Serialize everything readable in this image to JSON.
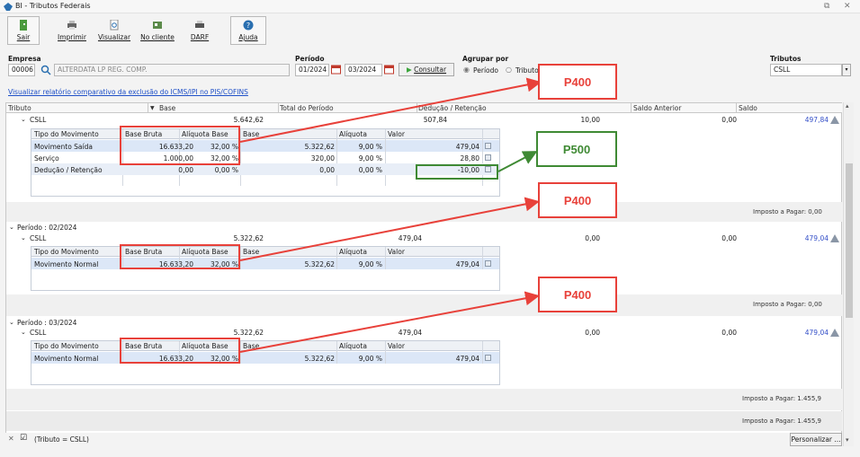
{
  "window": {
    "title": "BI - Tributos Federais"
  },
  "toolbar": {
    "sair": "Sair",
    "imprimir": "Imprimir",
    "visualizar": "Visualizar",
    "no_cliente": "No cliente",
    "darf": "DARF",
    "ajuda": "Ajuda"
  },
  "filters": {
    "empresa_label": "Empresa",
    "empresa_code": "00006",
    "empresa_name": "ALTERDATA LP REG. COMP.",
    "periodo_label": "Período",
    "periodo_inicio": "01/2024",
    "periodo_fim": "03/2024",
    "consultar": "Consultar",
    "agrupar_label": "Agrupar por",
    "agrupar_periodo": "Período",
    "agrupar_tributo": "Tributo",
    "tributos_label": "Tributos",
    "tributos_value": "CSLL"
  },
  "link": "Visualizar relatório comparativo da exclusão do ICMS/IPI no PIS/COFINS",
  "grid_header": {
    "tributo": "Tributo",
    "base": "Base",
    "total": "Total do Período",
    "deducao": "Dedução / Retenção",
    "saldo_anterior": "Saldo Anterior",
    "saldo": "Saldo"
  },
  "sub_headers": {
    "tipo": "Tipo do Movimento",
    "base_bruta": "Base Bruta",
    "aliquota_base": "Alíquota Base",
    "base": "Base",
    "aliquota": "Alíquota",
    "valor": "Valor"
  },
  "group1": {
    "name": "CSLL",
    "base": "5.642,62",
    "ded": "507,84",
    "saldo_ant": "10,00",
    "saldo_zero": "0,00",
    "saldo": "497,84",
    "rows": [
      {
        "tipo": "Movimento Saída",
        "base_bruta": "16.633,20",
        "aliq_base": "32,00 %",
        "base": "5.322,62",
        "aliq": "9,00 %",
        "valor": "479,04"
      },
      {
        "tipo": "Serviço",
        "base_bruta": "1.000,00",
        "aliq_base": "32,00 %",
        "base": "320,00",
        "aliq": "9,00 %",
        "valor": "28,80"
      },
      {
        "tipo": "Dedução / Retenção",
        "base_bruta": "0,00",
        "aliq_base": "0,00 %",
        "base": "0,00",
        "aliq": "0,00 %",
        "valor": "-10,00"
      }
    ],
    "imposto": "Imposto a Pagar: 0,00"
  },
  "group2": {
    "periodo": "Período : 02/2024",
    "name": "CSLL",
    "base": "5.322,62",
    "ded": "479,04",
    "saldo_ant": "0,00",
    "saldo_zero": "0,00",
    "saldo": "479,04",
    "row": {
      "tipo": "Movimento Normal",
      "base_bruta": "16.633,20",
      "aliq_base": "32,00 %",
      "base": "5.322,62",
      "aliq": "9,00 %",
      "valor": "479,04"
    },
    "imposto": "Imposto a Pagar: 0,00"
  },
  "group3": {
    "periodo": "Período : 03/2024",
    "name": "CSLL",
    "base": "5.322,62",
    "ded": "479,04",
    "saldo_ant": "0,00",
    "saldo_zero": "0,00",
    "saldo": "479,04",
    "row": {
      "tipo": "Movimento Normal",
      "base_bruta": "16.633,20",
      "aliq_base": "32,00 %",
      "base": "5.322,62",
      "aliq": "9,00 %",
      "valor": "479,04"
    },
    "imposto": "Imposto a Pagar: 1.455,9",
    "imposto_total": "Imposto a Pagar: 1.455,9"
  },
  "annotations": {
    "p400": "P400",
    "p500": "P500"
  },
  "status": {
    "filter": "(Tributo = CSLL)",
    "personalizar": "Personalizar ..."
  },
  "colors": {
    "red": "#e8413a",
    "green": "#3f8a34",
    "link": "#1f50c8",
    "selected_row": "#dce7f7"
  }
}
